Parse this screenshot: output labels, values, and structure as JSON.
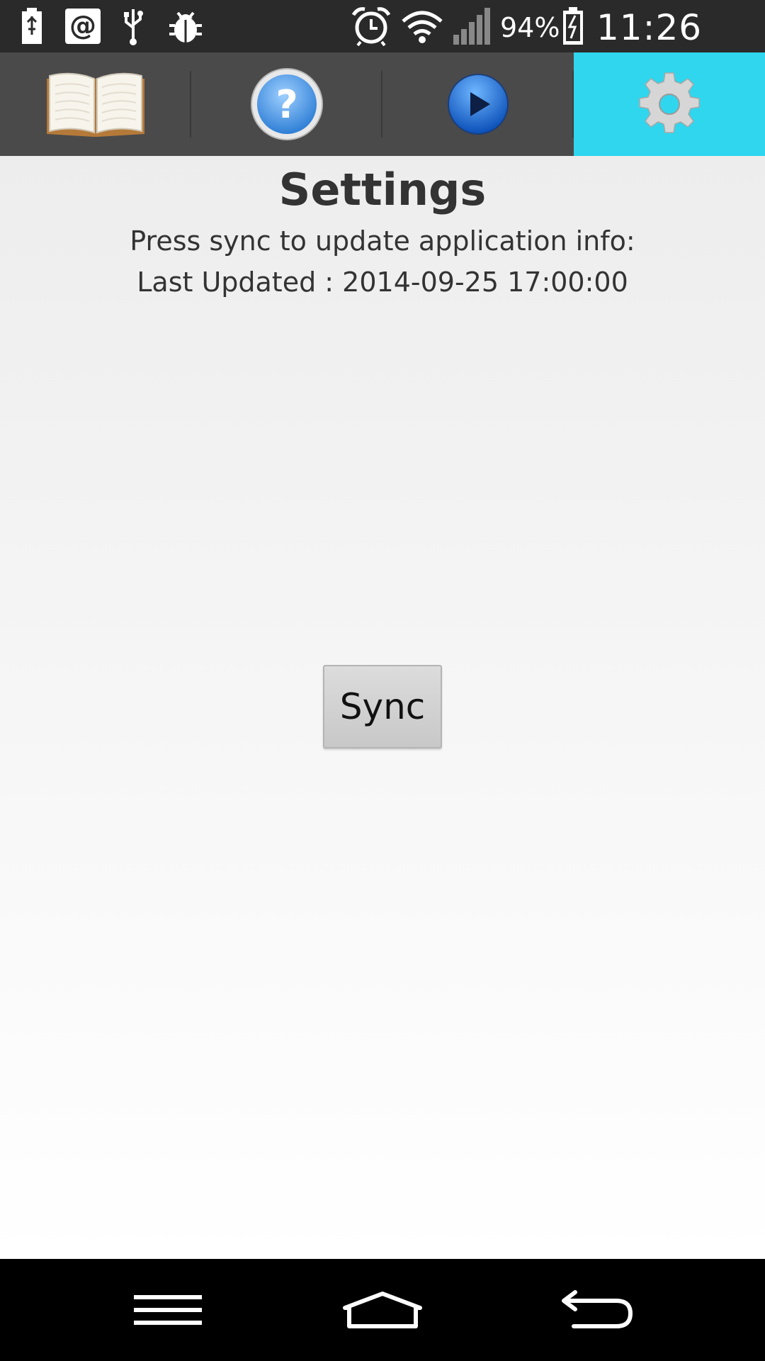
{
  "status_bar": {
    "left_icons": [
      "battery-saver-icon",
      "email-at-icon",
      "usb-icon",
      "bug-icon"
    ],
    "right_icons": [
      "alarm-icon",
      "wifi-icon",
      "signal-icon",
      "battery-charging-icon"
    ],
    "battery_percent": "94%",
    "time": "11:26 am"
  },
  "tabs": [
    {
      "icon": "book-icon",
      "active": false
    },
    {
      "icon": "help-icon",
      "active": false
    },
    {
      "icon": "play-icon",
      "active": false
    },
    {
      "icon": "gear-icon",
      "active": true
    }
  ],
  "colors": {
    "active_tab": "#2fd6ee",
    "tab_bar": "#4a4a4a",
    "status_bar": "#2a2a2a"
  },
  "page": {
    "title": "Settings",
    "description": "Press sync to update application info:",
    "last_updated": "Last Updated : 2014-09-25 17:00:00",
    "sync_label": "Sync"
  },
  "nav_bar": {
    "icons": [
      "menu-icon",
      "home-icon",
      "back-icon"
    ]
  }
}
